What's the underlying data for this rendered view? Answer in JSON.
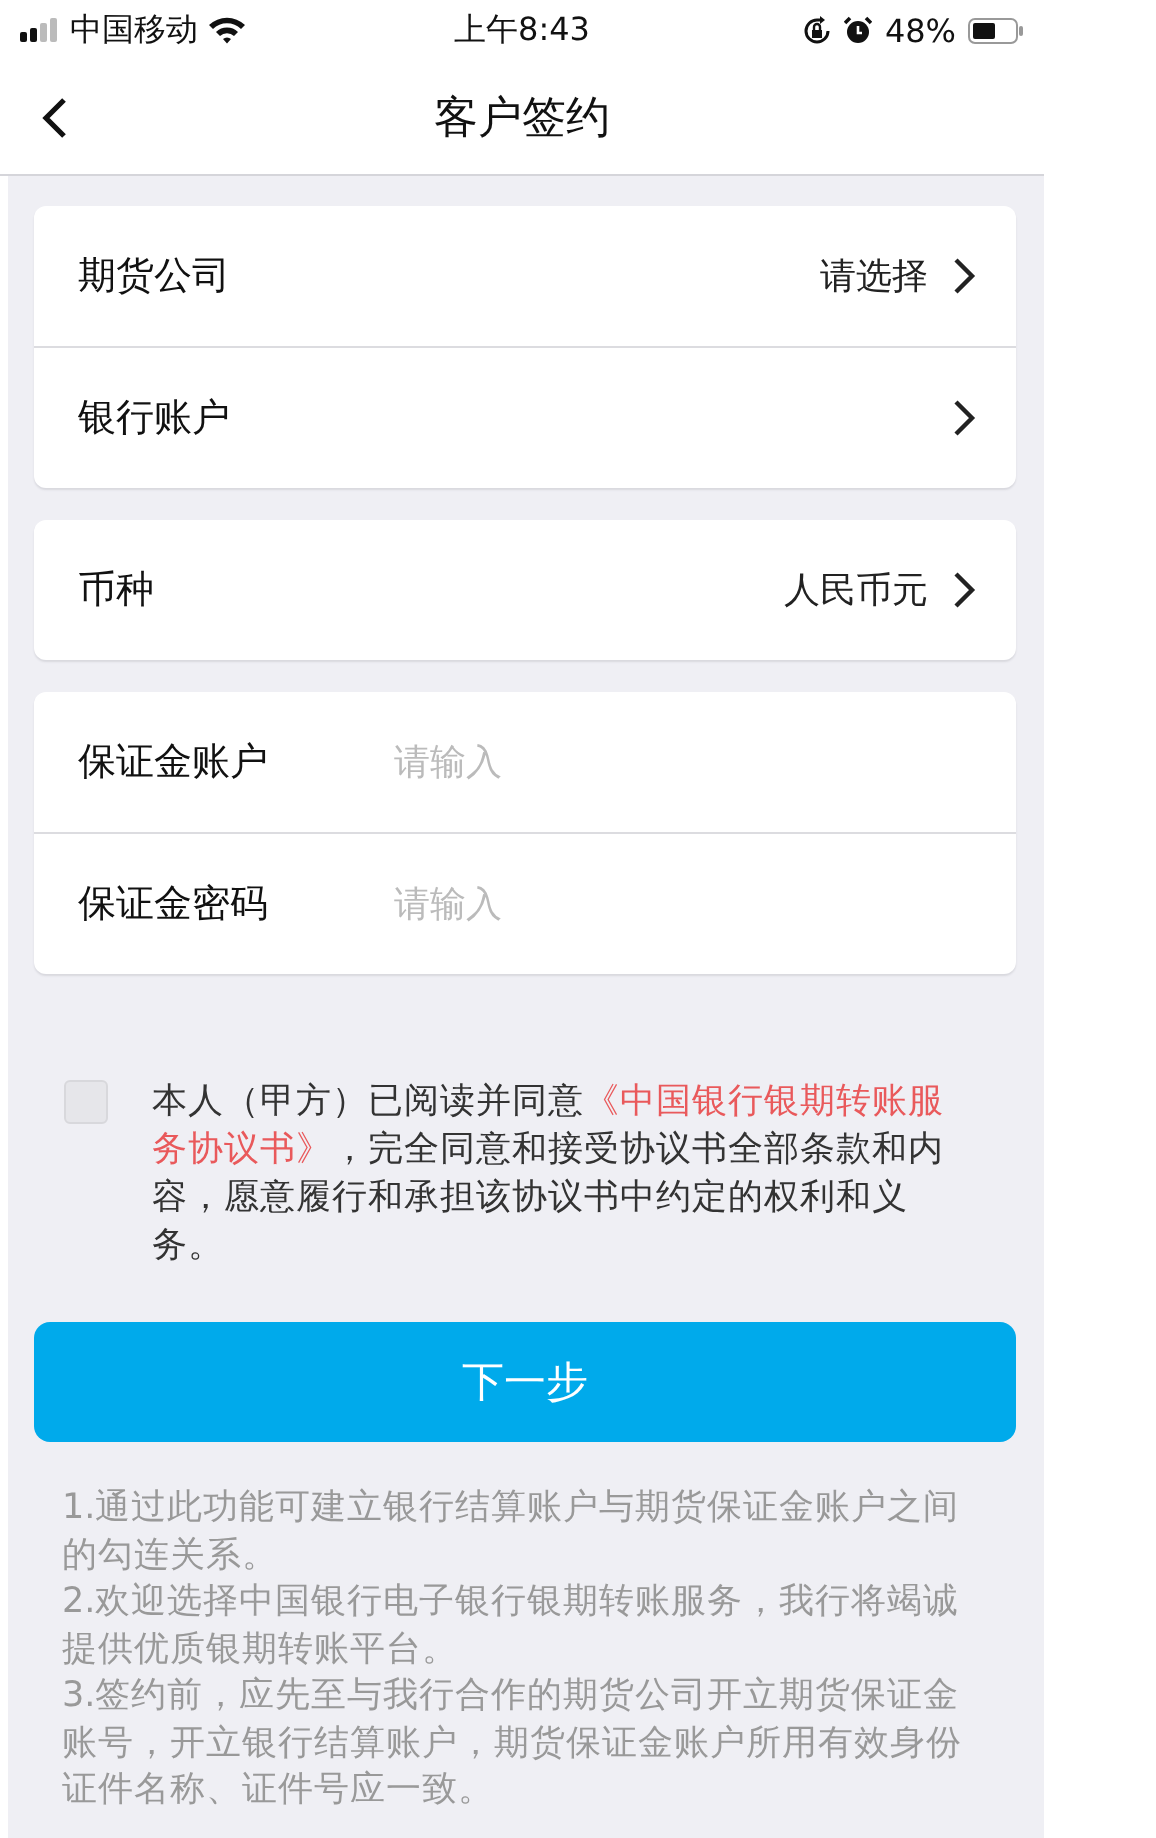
{
  "status_bar": {
    "carrier": "中国移动",
    "time": "上午8:43",
    "battery": "48%"
  },
  "nav": {
    "title": "客户签约"
  },
  "groups": [
    {
      "rows": [
        {
          "kind": "select",
          "label": "期货公司",
          "value": "请选择"
        },
        {
          "kind": "select",
          "label": "银行账户"
        }
      ]
    },
    {
      "rows": [
        {
          "kind": "select",
          "label": "币种",
          "value": "人民币元"
        }
      ]
    },
    {
      "rows": [
        {
          "kind": "input",
          "label": "保证金账户",
          "placeholder": "请输入"
        },
        {
          "kind": "input",
          "label": "保证金密码",
          "placeholder": "请输入"
        }
      ]
    }
  ],
  "agreement": {
    "checked": false,
    "before": "本人（甲方）已阅读并同意",
    "link_lines": [
      "《中国银行银期转账服",
      "务协议书》"
    ],
    "after": "，完全同意和接受协议书全部条款和内容，愿意履行和承担该协议书中约定的权利和义务。"
  },
  "next_button": "下一步",
  "notes": [
    "1.通过此功能可建立银行结算账户与期货保证金账户之间的勾连关系。",
    "2.欢迎选择中国银行电子银行银期转账服务，我行将竭诚提供优质银期转账平台。",
    "3.签约前，应先至与我行合作的期货公司开立期货保证金账号，开立银行结算账户，期货保证金账户所用有效身份证件名称、证件号应一致。"
  ]
}
